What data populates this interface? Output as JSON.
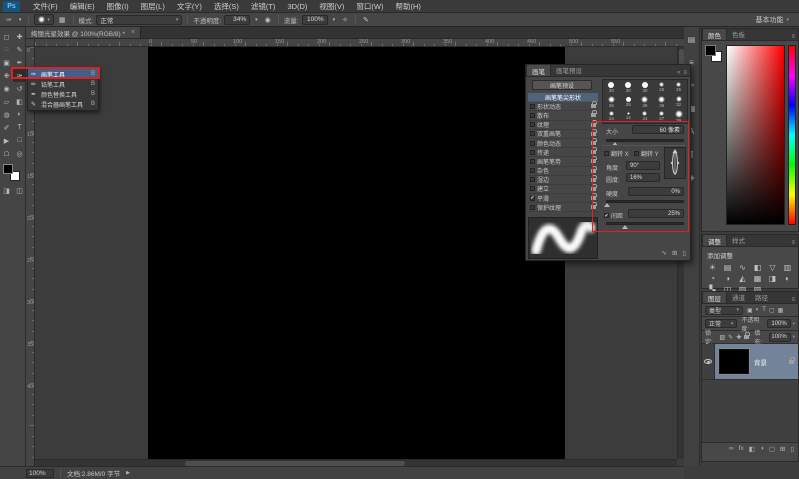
{
  "colors": {
    "annotation_red": "#e02020",
    "flyout_selection_blue": "#3e618c",
    "list_selection_blue": "#50637a",
    "layer_selection_gray_blue": "#72839a",
    "foreground_color": "#000000",
    "background_color": "#ffffff"
  },
  "menubar": {
    "logo": "Ps",
    "items": [
      "文件(F)",
      "编辑(E)",
      "图像(I)",
      "图层(L)",
      "文字(Y)",
      "选择(S)",
      "滤镜(T)",
      "3D(D)",
      "视图(V)",
      "窗口(W)",
      "帮助(H)"
    ]
  },
  "options_bar": {
    "mode_label": "模式:",
    "mode_value": "正常",
    "opacity_label": "不透明度:",
    "opacity_value": "34%",
    "flow_label": "流量:",
    "flow_value": "100%",
    "workspace_button": "基本功能"
  },
  "document_tab": {
    "title": "绚丽光星效果 @ 100%(RGB/8) *",
    "close_label": "×"
  },
  "toolbar": {
    "tools": [
      {
        "name": "rectangular-marquee-tool",
        "glyph": "◻"
      },
      {
        "name": "move-tool",
        "glyph": "✚"
      },
      {
        "name": "lasso-tool",
        "glyph": "◌"
      },
      {
        "name": "quick-selection-tool",
        "glyph": "✎"
      },
      {
        "name": "crop-tool",
        "glyph": "▣"
      },
      {
        "name": "eyedropper-tool",
        "glyph": "✒"
      },
      {
        "name": "healing-brush-tool",
        "glyph": "✙"
      },
      {
        "name": "brush-tool",
        "glyph": "✑",
        "selected": true
      },
      {
        "name": "clone-stamp-tool",
        "glyph": "◉"
      },
      {
        "name": "history-brush-tool",
        "glyph": "↺"
      },
      {
        "name": "eraser-tool",
        "glyph": "▱"
      },
      {
        "name": "gradient-tool",
        "glyph": "◧"
      },
      {
        "name": "blur-tool",
        "glyph": "◍"
      },
      {
        "name": "dodge-tool",
        "glyph": "◐"
      },
      {
        "name": "pen-tool",
        "glyph": "✐"
      },
      {
        "name": "type-tool",
        "glyph": "T"
      },
      {
        "name": "path-selection-tool",
        "glyph": "▶"
      },
      {
        "name": "shape-tool",
        "glyph": "□"
      },
      {
        "name": "hand-tool",
        "glyph": "☖"
      },
      {
        "name": "zoom-tool",
        "glyph": "◎"
      }
    ],
    "extra": [
      {
        "name": "quick-mask-icon",
        "glyph": "◨"
      },
      {
        "name": "screen-mode-icon",
        "glyph": "◫"
      }
    ]
  },
  "tool_flyout": {
    "items": [
      {
        "icon": "✑",
        "label": "画笔工具",
        "shortcut": "B",
        "selected": true
      },
      {
        "icon": "✏",
        "label": "铅笔工具",
        "shortcut": "B",
        "selected": false
      },
      {
        "icon": "✒",
        "label": "颜色替换工具",
        "shortcut": "B",
        "selected": false
      },
      {
        "icon": "✎",
        "label": "混合器画笔工具",
        "shortcut": "B",
        "selected": false
      }
    ]
  },
  "rulers": {
    "h_labels": [
      "0",
      "50",
      "100",
      "150",
      "200",
      "250",
      "300",
      "350",
      "400",
      "450",
      "500",
      "550"
    ],
    "v_labels": [
      "0",
      "50",
      "100",
      "150",
      "200",
      "250",
      "300",
      "350",
      "400"
    ]
  },
  "brush_panel": {
    "tabs": [
      "画笔",
      "画笔预设"
    ],
    "header_icons": [
      "«",
      "≡"
    ],
    "preset_button": "画笔预设",
    "tip_shape_label": "画笔笔尖形状",
    "options": [
      {
        "label": "形状动态",
        "checked": false
      },
      {
        "label": "散布",
        "checked": false
      },
      {
        "label": "纹理",
        "checked": false
      },
      {
        "label": "双重画笔",
        "checked": false
      },
      {
        "label": "颜色动态",
        "checked": false
      },
      {
        "label": "传递",
        "checked": false
      },
      {
        "label": "画笔笔势",
        "checked": false
      },
      {
        "label": "杂色",
        "checked": false
      },
      {
        "label": "湿边",
        "checked": false
      },
      {
        "label": "建立",
        "checked": false
      },
      {
        "label": "平滑",
        "checked": true
      },
      {
        "label": "保护纹理",
        "checked": false
      }
    ],
    "tips": [
      {
        "size": 30,
        "hard": true
      },
      {
        "size": 30,
        "hard": true
      },
      {
        "size": 30,
        "hard": true
      },
      {
        "size": 25,
        "hard": false
      },
      {
        "size": 25,
        "hard": false
      },
      {
        "size": 36,
        "hard": false
      },
      {
        "size": 25,
        "hard": true
      },
      {
        "size": 36,
        "hard": false
      },
      {
        "size": 36,
        "hard": false
      },
      {
        "size": 32,
        "hard": false
      },
      {
        "size": 24,
        "hard": false
      },
      {
        "size": 14,
        "hard": false
      },
      {
        "size": 24,
        "hard": false
      },
      {
        "size": 27,
        "hard": false
      },
      {
        "size": 39,
        "hard": false
      }
    ],
    "size_label": "大小",
    "size_value": "60 像素",
    "flip_x_label": "翻转 X",
    "flip_y_label": "翻转 Y",
    "angle_label": "角度:",
    "angle_value": "90°",
    "roundness_label": "圆度:",
    "roundness_value": "16%",
    "hardness_label": "硬度",
    "hardness_value": "0%",
    "spacing_label": "间距",
    "spacing_value": "25%",
    "spacing_checked": true,
    "bottom_icons": [
      {
        "name": "brush-stroke-preview-icon",
        "glyph": "∿"
      },
      {
        "name": "create-new-brush-icon",
        "glyph": "⊞"
      },
      {
        "name": "delete-brush-icon",
        "glyph": "▯"
      }
    ]
  },
  "dock_icons": [
    {
      "name": "history-panel-icon",
      "glyph": "▤"
    },
    {
      "name": "properties-panel-icon",
      "glyph": "≡"
    },
    {
      "name": "brush-panel-icon",
      "glyph": "✑"
    },
    {
      "name": "clone-source-panel-icon",
      "glyph": "▦"
    },
    {
      "name": "character-panel-icon",
      "glyph": "A"
    },
    {
      "name": "paragraph-panel-icon",
      "glyph": "¶"
    },
    {
      "name": "layer-comps-panel-icon",
      "glyph": "◈"
    }
  ],
  "color_panel": {
    "tabs": [
      "颜色",
      "色板"
    ],
    "menu_icon": "≡"
  },
  "adjustments_panel": {
    "tabs": [
      "调整",
      "样式"
    ],
    "header": "添加调整",
    "menu_icon": "≡",
    "icons": [
      {
        "name": "brightness-contrast-icon",
        "glyph": "☀"
      },
      {
        "name": "levels-icon",
        "glyph": "▤"
      },
      {
        "name": "curves-icon",
        "glyph": "∿"
      },
      {
        "name": "exposure-icon",
        "glyph": "◧"
      },
      {
        "name": "vibrance-icon",
        "glyph": "▽"
      },
      {
        "name": "hue-saturation-icon",
        "glyph": "▥"
      },
      {
        "name": "color-balance-icon",
        "glyph": "◔"
      },
      {
        "name": "black-white-icon",
        "glyph": "◑"
      },
      {
        "name": "photo-filter-icon",
        "glyph": "◭"
      },
      {
        "name": "channel-mixer-icon",
        "glyph": "▦"
      },
      {
        "name": "color-lookup-icon",
        "glyph": "◨"
      },
      {
        "name": "invert-icon",
        "glyph": "◐"
      },
      {
        "name": "posterize-icon",
        "glyph": "▚"
      },
      {
        "name": "threshold-icon",
        "glyph": "◫"
      },
      {
        "name": "gradient-map-icon",
        "glyph": "▨"
      },
      {
        "name": "selective-color-icon",
        "glyph": "▧"
      }
    ]
  },
  "layers_panel": {
    "tabs": [
      "图层",
      "通道",
      "路径"
    ],
    "menu_icon": "≡",
    "filter_label": "类型",
    "filter_icons": [
      {
        "name": "filter-pixel-layers-icon",
        "glyph": "▣"
      },
      {
        "name": "filter-adjustment-layers-icon",
        "glyph": "◐"
      },
      {
        "name": "filter-type-layers-icon",
        "glyph": "T"
      },
      {
        "name": "filter-shape-layers-icon",
        "glyph": "▢"
      },
      {
        "name": "filter-smart-objects-icon",
        "glyph": "▦"
      }
    ],
    "blend_mode": "正常",
    "opacity_label": "不透明度:",
    "opacity_value": "100%",
    "lock_label": "锁定:",
    "lock_icons": [
      {
        "name": "lock-transparent-pixels-icon",
        "glyph": "▨"
      },
      {
        "name": "lock-image-pixels-icon",
        "glyph": "✎"
      },
      {
        "name": "lock-position-icon",
        "glyph": "✚"
      },
      {
        "name": "lock-all-icon",
        "glyph": "css-lock"
      }
    ],
    "fill_label": "填充:",
    "fill_value": "100%",
    "layers": [
      {
        "name": "背景",
        "visible": true,
        "locked": true,
        "selected": true
      }
    ],
    "bottom_icons": [
      {
        "name": "link-layers-icon",
        "glyph": "∞"
      },
      {
        "name": "layer-style-icon",
        "glyph": "fx"
      },
      {
        "name": "add-layer-mask-icon",
        "glyph": "◧"
      },
      {
        "name": "new-adjustment-layer-icon",
        "glyph": "◑"
      },
      {
        "name": "new-group-icon",
        "glyph": "▢"
      },
      {
        "name": "new-layer-icon",
        "glyph": "⊞"
      },
      {
        "name": "delete-layer-icon",
        "glyph": "▯"
      }
    ]
  },
  "status_bar": {
    "zoom": "100%",
    "doc_info": "文档:2.86M/0 字节",
    "arrow": "▶"
  }
}
